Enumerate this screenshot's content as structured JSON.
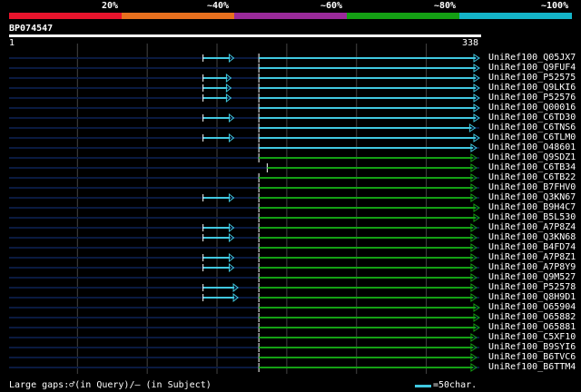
{
  "scale": {
    "labels": [
      "20%",
      "~40%",
      "~60%",
      "~80%",
      "~100%"
    ],
    "colors": [
      "#e8142c",
      "#e8701e",
      "#9a2a9a",
      "#14a014",
      "#14b4c8"
    ]
  },
  "query": {
    "name": "BP074547",
    "start": "1",
    "end": "338",
    "length": 338
  },
  "colors": {
    "background": "#000000",
    "track": "#0a1a40",
    "grid": "#444444",
    "cyan_hit": "#40c8e0",
    "green_hit": "#14a014",
    "white": "#ffffff"
  },
  "hits": [
    {
      "name": "UniRef100_Q05JX7",
      "small": [
        [
          140,
          162
        ]
      ],
      "main": [
        180,
        338
      ],
      "color": "cyan"
    },
    {
      "name": "UniRef100_Q9FUF4",
      "small": [],
      "main": [
        180,
        338
      ],
      "color": "cyan"
    },
    {
      "name": "UniRef100_P52575",
      "small": [
        [
          140,
          160
        ]
      ],
      "main": [
        180,
        338
      ],
      "color": "cyan"
    },
    {
      "name": "UniRef100_Q9LKI6",
      "small": [
        [
          140,
          160
        ]
      ],
      "main": [
        180,
        338
      ],
      "color": "cyan"
    },
    {
      "name": "UniRef100_P52576",
      "small": [
        [
          140,
          160
        ]
      ],
      "main": [
        180,
        338
      ],
      "color": "cyan"
    },
    {
      "name": "UniRef100_Q00016",
      "small": [],
      "main": [
        180,
        338
      ],
      "color": "cyan"
    },
    {
      "name": "UniRef100_C6TD30",
      "small": [
        [
          140,
          162
        ]
      ],
      "main": [
        180,
        338
      ],
      "color": "cyan"
    },
    {
      "name": "UniRef100_C6TNS6",
      "small": [],
      "main": [
        180,
        335
      ],
      "color": "cyan"
    },
    {
      "name": "UniRef100_C6TLM0",
      "small": [
        [
          140,
          162
        ]
      ],
      "main": [
        180,
        338
      ],
      "color": "cyan"
    },
    {
      "name": "UniRef100_O48601",
      "small": [],
      "main": [
        180,
        336
      ],
      "color": "cyan"
    },
    {
      "name": "UniRef100_Q9SDZ1",
      "small": [],
      "main": [
        180,
        336
      ],
      "color": "green"
    },
    {
      "name": "UniRef100_C6TB34",
      "small": [],
      "main": [
        186,
        336
      ],
      "color": "green"
    },
    {
      "name": "UniRef100_C6TB22",
      "small": [],
      "main": [
        180,
        336
      ],
      "color": "green"
    },
    {
      "name": "UniRef100_B7FHV0",
      "small": [],
      "main": [
        180,
        336
      ],
      "color": "green"
    },
    {
      "name": "UniRef100_Q3KN67",
      "small": [
        [
          140,
          162
        ]
      ],
      "main": [
        180,
        336
      ],
      "color": "green"
    },
    {
      "name": "UniRef100_B9H4C7",
      "small": [],
      "main": [
        180,
        338
      ],
      "color": "green"
    },
    {
      "name": "UniRef100_B5L530",
      "small": [],
      "main": [
        180,
        338
      ],
      "color": "green"
    },
    {
      "name": "UniRef100_A7P8Z4",
      "small": [
        [
          140,
          162
        ]
      ],
      "main": [
        180,
        336
      ],
      "color": "green"
    },
    {
      "name": "UniRef100_Q3KN68",
      "small": [
        [
          140,
          162
        ]
      ],
      "main": [
        180,
        336
      ],
      "color": "green"
    },
    {
      "name": "UniRef100_B4FD74",
      "small": [],
      "main": [
        180,
        336
      ],
      "color": "green"
    },
    {
      "name": "UniRef100_A7P8Z1",
      "small": [
        [
          140,
          162
        ]
      ],
      "main": [
        180,
        336
      ],
      "color": "green"
    },
    {
      "name": "UniRef100_A7P8Y9",
      "small": [
        [
          140,
          162
        ]
      ],
      "main": [
        180,
        336
      ],
      "color": "green"
    },
    {
      "name": "UniRef100_Q9M527",
      "small": [],
      "main": [
        180,
        336
      ],
      "color": "green"
    },
    {
      "name": "UniRef100_P52578",
      "small": [
        [
          140,
          165
        ]
      ],
      "main": [
        180,
        336
      ],
      "color": "green"
    },
    {
      "name": "UniRef100_Q8H9D1",
      "small": [
        [
          140,
          165
        ]
      ],
      "main": [
        180,
        336
      ],
      "color": "green"
    },
    {
      "name": "UniRef100_O65904",
      "small": [],
      "main": [
        180,
        338
      ],
      "color": "green"
    },
    {
      "name": "UniRef100_O65882",
      "small": [],
      "main": [
        180,
        338
      ],
      "color": "green"
    },
    {
      "name": "UniRef100_O65881",
      "small": [],
      "main": [
        180,
        338
      ],
      "color": "green"
    },
    {
      "name": "UniRef100_C5XF10",
      "small": [],
      "main": [
        180,
        336
      ],
      "color": "green"
    },
    {
      "name": "UniRef100_B9SYI6",
      "small": [],
      "main": [
        180,
        336
      ],
      "color": "green"
    },
    {
      "name": "UniRef100_B6TVC6",
      "small": [],
      "main": [
        180,
        336
      ],
      "color": "green"
    },
    {
      "name": "UniRef100_B6TTM4",
      "small": [],
      "main": [
        180,
        336
      ],
      "color": "green"
    }
  ],
  "legend": {
    "gaps_text": "Large gaps:♂(in Query)/– (in Subject)",
    "scale_text": "=50char."
  }
}
